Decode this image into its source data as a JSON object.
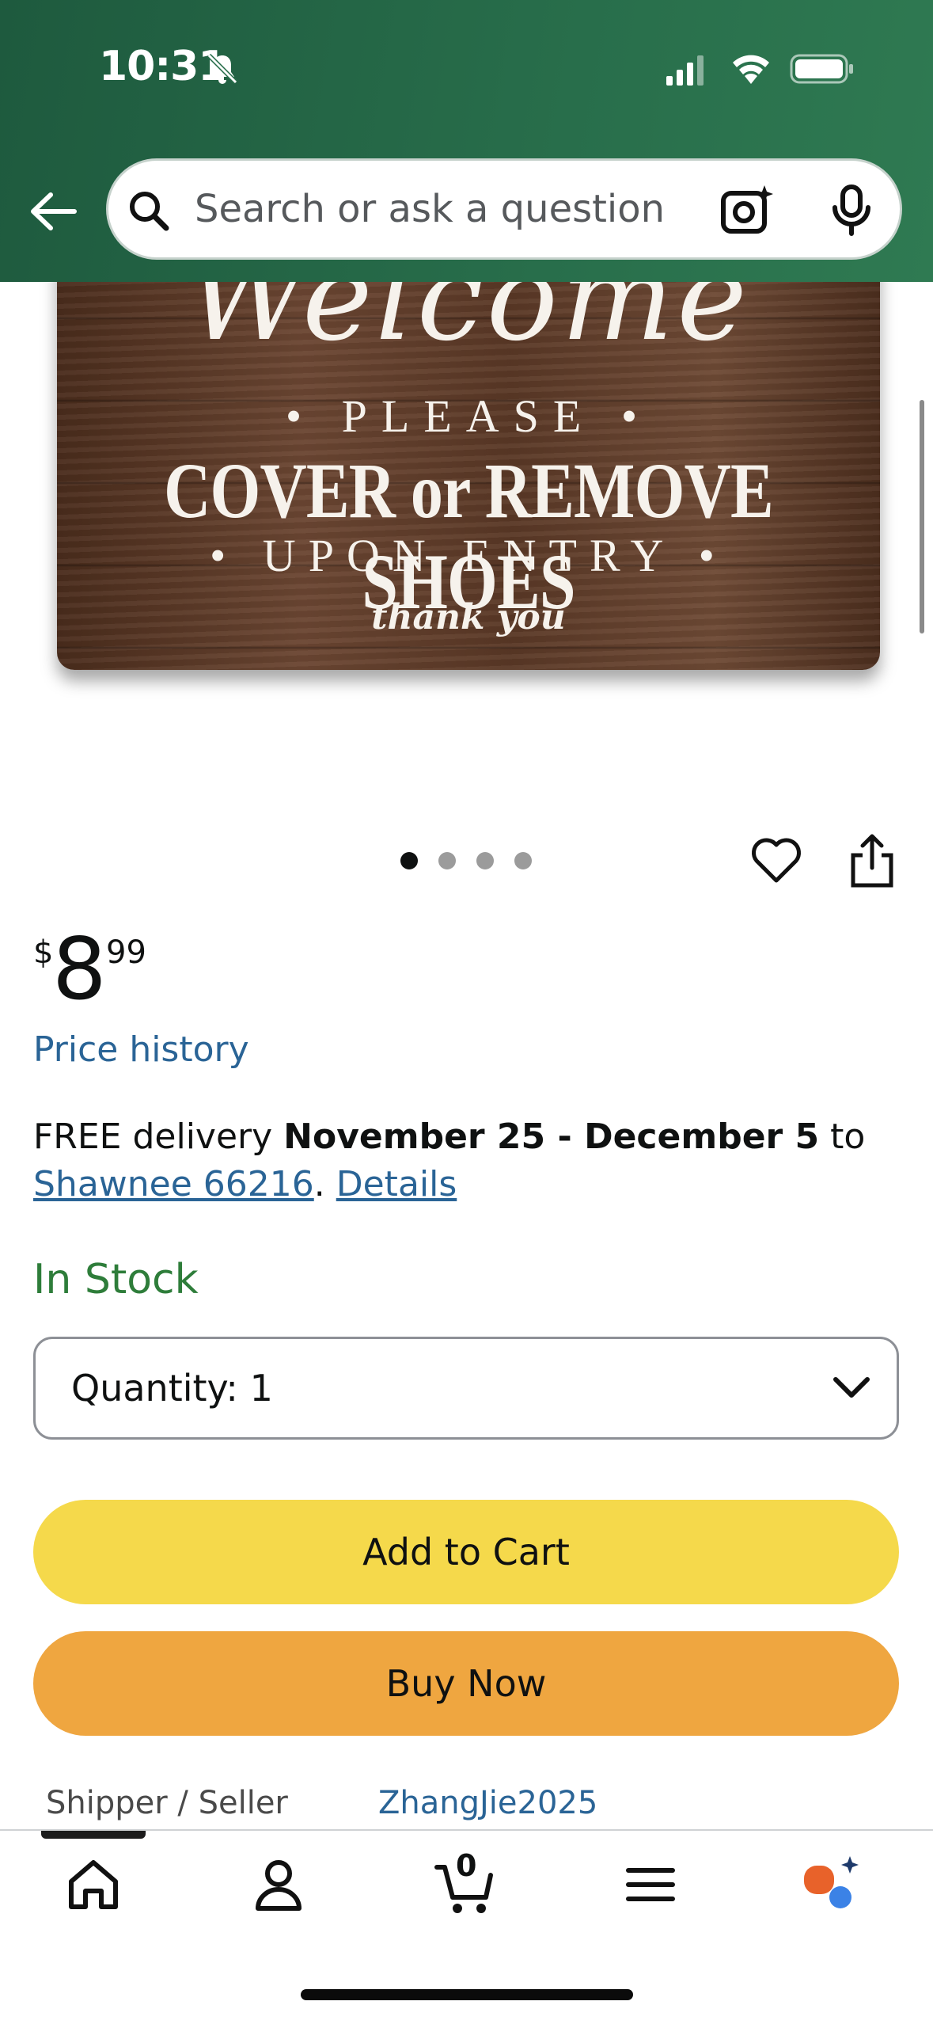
{
  "status_bar": {
    "time": "10:31",
    "icons": [
      "bell-slash-icon",
      "cellular-signal-icon",
      "wifi-icon",
      "battery-icon"
    ]
  },
  "header": {
    "back_icon": "back-arrow-icon",
    "search": {
      "placeholder": "Search or ask a question",
      "icons": [
        "search-icon",
        "camera-lens-icon",
        "microphone-icon"
      ]
    }
  },
  "product_image": {
    "line1": "Welcome",
    "line2": "• PLEASE •",
    "line3": "COVER or REMOVE SHOES",
    "line4": "• UPON ENTRY •",
    "line5": "thank you",
    "carousel": {
      "count": 4,
      "active_index": 0
    }
  },
  "price": {
    "currency": "$",
    "whole": "8",
    "fraction": "99",
    "history_link": "Price history"
  },
  "delivery": {
    "prefix": "FREE delivery ",
    "dates": "November 25 - December 5",
    "to": " to",
    "location": "Shawnee 66216",
    "sep": ". ",
    "details_link": "Details"
  },
  "availability": "In Stock",
  "quantity": {
    "label": "Quantity:",
    "value": "1"
  },
  "buttons": {
    "add_to_cart": "Add to Cart",
    "buy_now": "Buy Now"
  },
  "seller": {
    "label": "Shipper / Seller",
    "value": "ZhangJie2025"
  },
  "bottom_nav": {
    "items": [
      "home-icon",
      "account-icon",
      "cart-icon",
      "menu-icon",
      "rufus-ai-icon"
    ],
    "cart_count": "0",
    "active_index": 0
  },
  "colors": {
    "header": "#286e4b",
    "add_to_cart": "#f5d94b",
    "buy_now": "#efa640",
    "link": "#2a6496",
    "in_stock": "#2e7d3a"
  }
}
